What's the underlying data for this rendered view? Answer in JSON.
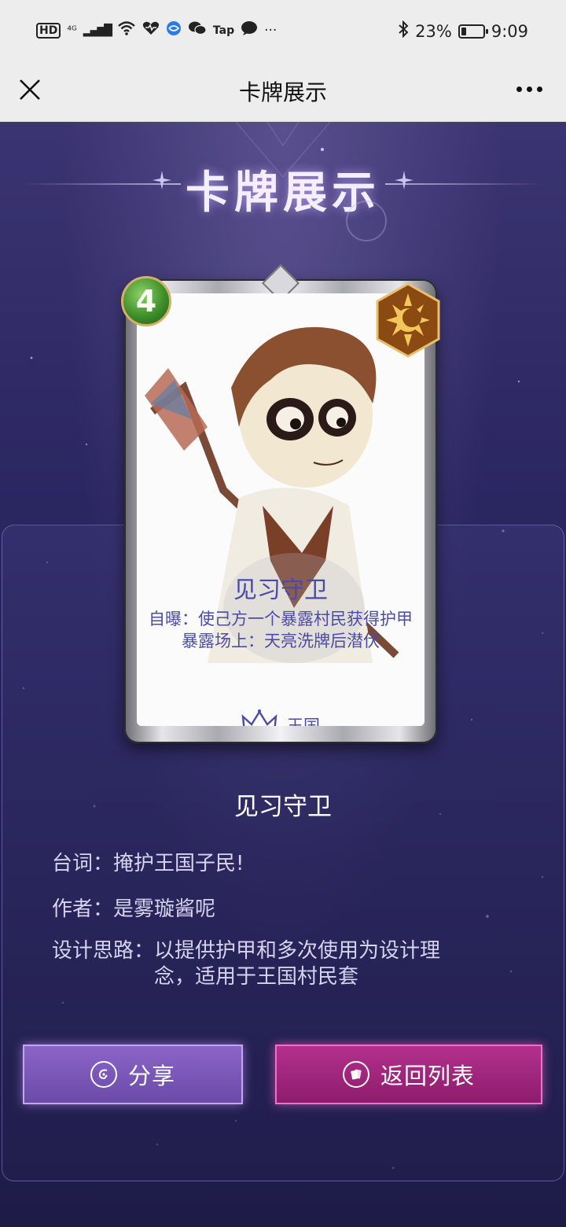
{
  "status_bar": {
    "left_icons": [
      "HD",
      "⁴ᴳ",
      "▂▄▆█",
      "wifi-icon",
      "heart-icon",
      "browser-icon",
      "wechat-icon",
      "Tap",
      "message-icon",
      "···"
    ],
    "battery_percent": "23%",
    "battery_level": 0.23,
    "time": "9:09"
  },
  "nav": {
    "title": "卡牌展示"
  },
  "header": {
    "title": "卡牌展示"
  },
  "card": {
    "cost": "4",
    "name": "见习守卫",
    "description": "自曝：使己方一个暴露村民获得护甲 暴露场上：天亮洗牌后潜伏",
    "faction": "王国",
    "cost_color": "#3f8f2a",
    "class_icon": "sun-moon-icon"
  },
  "info": {
    "name": "见习守卫",
    "quote_label": "台词：",
    "quote_value": "掩护王国子民!",
    "author_label": "作者：",
    "author_value": "是雾璇酱呢",
    "design_label": "设计思路：",
    "design_value": "以提供护甲和多次使用为设计理念，适用于王国村民套"
  },
  "buttons": {
    "share_label": "分享",
    "back_label": "返回列表",
    "share_color": "#7a57b8",
    "back_color": "#a0267c"
  }
}
